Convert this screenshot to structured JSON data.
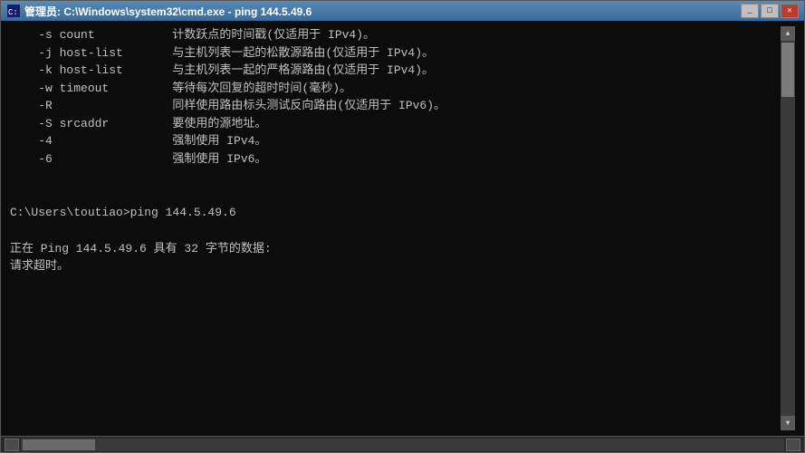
{
  "window": {
    "title": "管理员: C:\\Windows\\system32\\cmd.exe - ping  144.5.49.6",
    "title_icon": "cmd-icon"
  },
  "titlebar": {
    "minimize_label": "_",
    "maximize_label": "□",
    "close_label": "✕"
  },
  "console": {
    "lines": [
      "    -s count           计数跃点的时间戳(仅适用于 IPv4)。",
      "    -j host-list       与主机列表一起的松散源路由(仅适用于 IPv4)。",
      "    -k host-list       与主机列表一起的严格源路由(仅适用于 IPv4)。",
      "    -w timeout         等待每次回复的超时时间(毫秒)。",
      "    -R                 同样使用路由标头测试反向路由(仅适用于 IPv6)。",
      "    -S srcaddr         要使用的源地址。",
      "    -4                 强制使用 IPv4。",
      "    -6                 强制使用 IPv6。",
      "",
      "",
      "C:\\Users\\toutiao>ping 144.5.49.6",
      "",
      "正在 Ping 144.5.49.6 具有 32 字节的数据:",
      "请求超时。"
    ]
  }
}
